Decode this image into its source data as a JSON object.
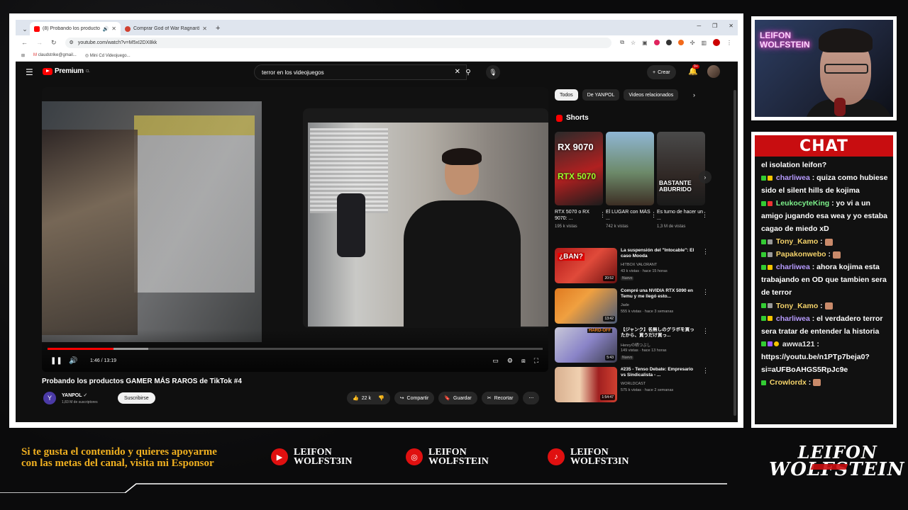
{
  "browser": {
    "tabs": [
      {
        "label": "(8) Probando los productos",
        "active": true
      },
      {
        "label": "Comprar God of War Ragnarök",
        "active": false
      }
    ],
    "url": "youtube.com/watch?v=M5xI2DX8kk",
    "bookmarks": [
      "claudstrike@gmail...",
      "Mini Cd Videojuego..."
    ]
  },
  "youtube": {
    "logo_label": "Premium",
    "logo_region": "CL",
    "search_query": "terror en los videojuegos",
    "create_label": "Crear",
    "notif_count": "9+",
    "player": {
      "time": "1:46 / 13:19",
      "progress": 0.133
    },
    "video_title": "Probando los productos GAMER MÁS RAROS de TikTok #4",
    "channel": {
      "name": "YANPOL",
      "subscribers": "1,83 M de suscriptores",
      "subscribe_label": "Suscribirse"
    },
    "actions": {
      "likes": "22 k",
      "share": "Compartir",
      "save": "Guardar",
      "clip": "Recortar"
    },
    "chips": [
      "Todos",
      "De YANPOL",
      "Videos relacionados"
    ],
    "shorts_label": "Shorts",
    "shorts": [
      {
        "title": "RTX 5070 o RX 9070: ...",
        "views": "195 k vistas",
        "thumb_text": "RX 9070"
      },
      {
        "title": "El LUGAR con MÁS ...",
        "views": "742 k vistas",
        "thumb_text": ""
      },
      {
        "title": "Es turno de hacer un ...",
        "views": "1,3 M de vistas",
        "thumb_text": "BASTANTE ABURRIDO"
      }
    ],
    "recommended": [
      {
        "title": "La suspensión del \"Intocable\": El caso Mooda",
        "channel": "HITBOX VALORANT",
        "views": "43 k vistas · hace 15 horas",
        "duration": "20:52",
        "new": "Nuevo",
        "thumb_text": "¿BAN?"
      },
      {
        "title": "Compré una NVIDIA RTX 5090 en Temu y me llegó esto...",
        "channel": "Jade",
        "views": "555 k vistas · hace 3 semanas",
        "duration": "13:42",
        "new": "",
        "thumb_text": ""
      },
      {
        "title": "【ジャンク】名無しのグラボを買ったから、買うだけ買っ...",
        "channel": "Henryの晒つぶし",
        "views": "149 vistas · hace 13 horas",
        "duration": "5:43",
        "new": "Nuevo",
        "thumb_text": "HARD-OFF"
      },
      {
        "title": "#235 - Tenso Debate: Empresario vs Sindicalista - ...",
        "channel": "WORLDCAST",
        "views": "575 k vistas · hace 2 semanas",
        "duration": "1:54:47",
        "new": "",
        "thumb_text": ""
      }
    ]
  },
  "webcam": {
    "neon_line1": "LEIFON",
    "neon_line2": "WOLFSTEIN"
  },
  "chat": {
    "title": "CHAT",
    "messages": [
      {
        "user": "",
        "text": "el isolation leifon?"
      },
      {
        "user": "charliwea",
        "text": "quiza como hubiese sido el silent hills de kojima"
      },
      {
        "user": "LeukocyteKing",
        "text": "yo vi a un amigo jugando esa wea y yo estaba cagao de miedo xD"
      },
      {
        "user": "Tony_Kamo",
        "text": ""
      },
      {
        "user": "Papakonwebo",
        "text": ""
      },
      {
        "user": "charliwea",
        "text": "ahora kojima esta trabajando en OD que tambien sera de terror"
      },
      {
        "user": "Tony_Kamo",
        "text": ""
      },
      {
        "user": "charliwea",
        "text": "el verdadero terror sera tratar de entender la historia"
      },
      {
        "user": "awwa121",
        "text": "https://youtu.be/n1PTp7beja0?si=aUFBoAHGS5RpJc9e"
      },
      {
        "user": "Crowlordx",
        "text": ""
      }
    ]
  },
  "overlay": {
    "sponsor_text": "Si te gusta el contenido y quieres apoyarme con las metas del canal, visita mi Esponsor",
    "socials": [
      {
        "platform": "youtube-icon",
        "line1": "LEIFON",
        "line2": "WOLFST3IN"
      },
      {
        "platform": "instagram-icon",
        "line1": "LEIFON",
        "line2": "WOLFSTEIN"
      },
      {
        "platform": "tiktok-icon",
        "line1": "LEIFON",
        "line2": "WOLFST3IN"
      }
    ],
    "brand_line1": "LEIFON",
    "brand_line2": "WOLFSTEIN"
  },
  "colors": {
    "accent": "#c80d10",
    "gold": "#f0b020",
    "youtube_red": "#ff0000"
  }
}
